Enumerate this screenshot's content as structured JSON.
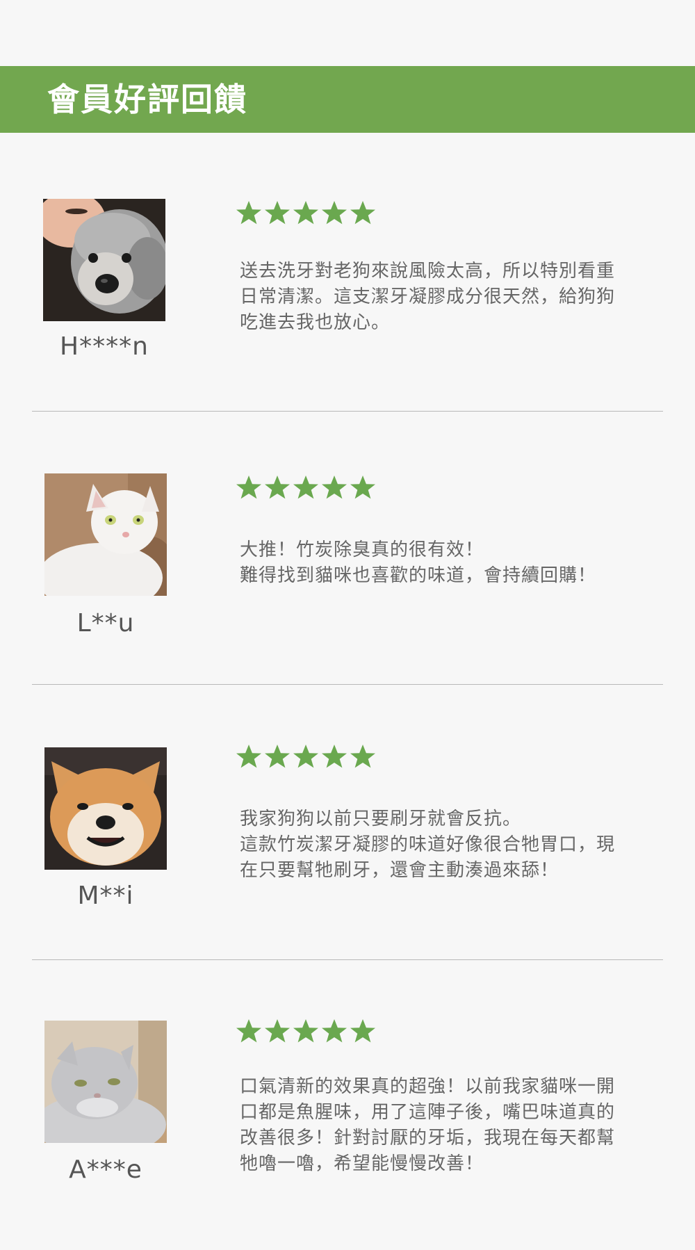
{
  "header": {
    "title": "會員好評回饋",
    "color": "#72a74f"
  },
  "star_color": "#6aa84f",
  "reviews": [
    {
      "name": "H****n",
      "rating": 5,
      "avatar": "dog-poodle-photo",
      "text": "送去洗牙對老狗來說風險太高，所以特別看重\n日常清潔。這支潔牙凝膠成分很天然，給狗狗\n吃進去我也放心。"
    },
    {
      "name": "L**u",
      "rating": 5,
      "avatar": "white-cat-photo",
      "text": "大推！竹炭除臭真的很有效！\n難得找到貓咪也喜歡的味道，會持續回購！"
    },
    {
      "name": "M**i",
      "rating": 5,
      "avatar": "shiba-dog-photo",
      "text": "我家狗狗以前只要刷牙就會反抗。\n這款竹炭潔牙凝膠的味道好像很合牠胃口，現\n在只要幫牠刷牙，還會主動湊過來舔！"
    },
    {
      "name": "A***e",
      "rating": 5,
      "avatar": "grey-cat-photo",
      "text": "口氣清新的效果真的超強！以前我家貓咪一開\n口都是魚腥味，用了這陣子後，嘴巴味道真的\n改善很多！針對討厭的牙垢，我現在每天都幫\n牠嚕一嚕，希望能慢慢改善！"
    }
  ]
}
